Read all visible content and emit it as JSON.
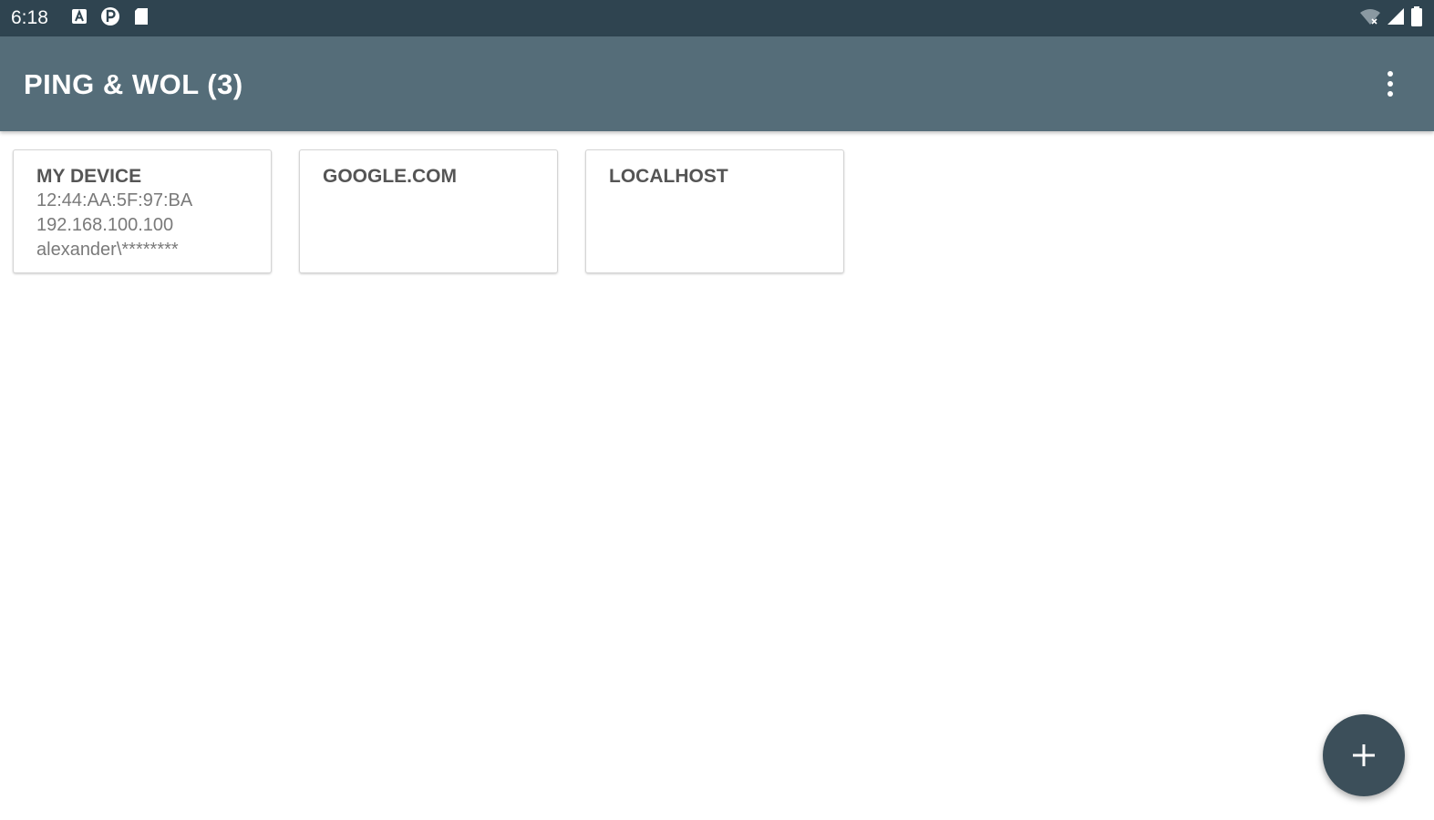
{
  "status_bar": {
    "time": "6:18",
    "left_icons": [
      "notification-a-icon",
      "notification-p-icon",
      "sd-card-icon"
    ],
    "right_icons": [
      "wifi-icon",
      "signal-icon",
      "battery-icon"
    ]
  },
  "app_bar": {
    "title": "PING & WOL (3)",
    "menu_icon": "overflow-menu-icon"
  },
  "devices": [
    {
      "name": "MY DEVICE",
      "mac": "12:44:AA:5F:97:BA",
      "ip": "192.168.100.100",
      "user": "alexander\\********"
    },
    {
      "name": "GOOGLE.COM"
    },
    {
      "name": "LOCALHOST"
    }
  ],
  "fab": {
    "icon": "plus-icon"
  },
  "colors": {
    "status_bar": "#2f4450",
    "app_bar": "#556d79",
    "fab": "#3c4f5a"
  }
}
